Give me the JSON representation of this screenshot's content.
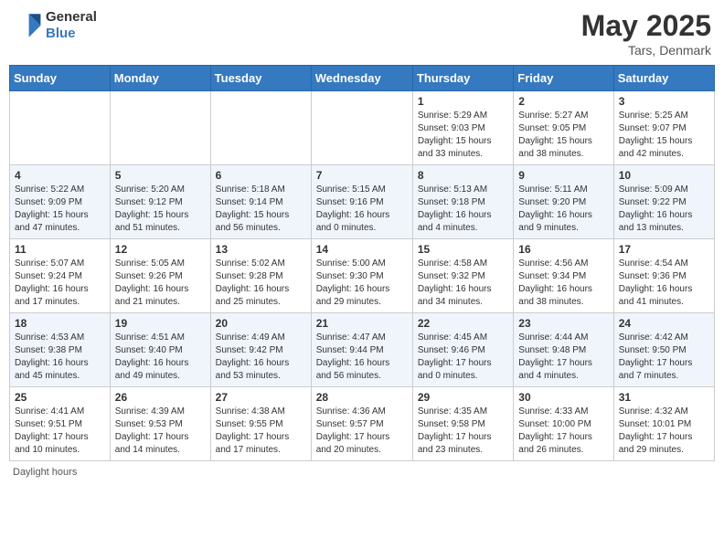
{
  "header": {
    "logo_line1": "General",
    "logo_line2": "Blue",
    "month_year": "May 2025",
    "location": "Tars, Denmark"
  },
  "days_of_week": [
    "Sunday",
    "Monday",
    "Tuesday",
    "Wednesday",
    "Thursday",
    "Friday",
    "Saturday"
  ],
  "weeks": [
    [
      {
        "day": "",
        "info": ""
      },
      {
        "day": "",
        "info": ""
      },
      {
        "day": "",
        "info": ""
      },
      {
        "day": "",
        "info": ""
      },
      {
        "day": "1",
        "info": "Sunrise: 5:29 AM\nSunset: 9:03 PM\nDaylight: 15 hours\nand 33 minutes."
      },
      {
        "day": "2",
        "info": "Sunrise: 5:27 AM\nSunset: 9:05 PM\nDaylight: 15 hours\nand 38 minutes."
      },
      {
        "day": "3",
        "info": "Sunrise: 5:25 AM\nSunset: 9:07 PM\nDaylight: 15 hours\nand 42 minutes."
      }
    ],
    [
      {
        "day": "4",
        "info": "Sunrise: 5:22 AM\nSunset: 9:09 PM\nDaylight: 15 hours\nand 47 minutes."
      },
      {
        "day": "5",
        "info": "Sunrise: 5:20 AM\nSunset: 9:12 PM\nDaylight: 15 hours\nand 51 minutes."
      },
      {
        "day": "6",
        "info": "Sunrise: 5:18 AM\nSunset: 9:14 PM\nDaylight: 15 hours\nand 56 minutes."
      },
      {
        "day": "7",
        "info": "Sunrise: 5:15 AM\nSunset: 9:16 PM\nDaylight: 16 hours\nand 0 minutes."
      },
      {
        "day": "8",
        "info": "Sunrise: 5:13 AM\nSunset: 9:18 PM\nDaylight: 16 hours\nand 4 minutes."
      },
      {
        "day": "9",
        "info": "Sunrise: 5:11 AM\nSunset: 9:20 PM\nDaylight: 16 hours\nand 9 minutes."
      },
      {
        "day": "10",
        "info": "Sunrise: 5:09 AM\nSunset: 9:22 PM\nDaylight: 16 hours\nand 13 minutes."
      }
    ],
    [
      {
        "day": "11",
        "info": "Sunrise: 5:07 AM\nSunset: 9:24 PM\nDaylight: 16 hours\nand 17 minutes."
      },
      {
        "day": "12",
        "info": "Sunrise: 5:05 AM\nSunset: 9:26 PM\nDaylight: 16 hours\nand 21 minutes."
      },
      {
        "day": "13",
        "info": "Sunrise: 5:02 AM\nSunset: 9:28 PM\nDaylight: 16 hours\nand 25 minutes."
      },
      {
        "day": "14",
        "info": "Sunrise: 5:00 AM\nSunset: 9:30 PM\nDaylight: 16 hours\nand 29 minutes."
      },
      {
        "day": "15",
        "info": "Sunrise: 4:58 AM\nSunset: 9:32 PM\nDaylight: 16 hours\nand 34 minutes."
      },
      {
        "day": "16",
        "info": "Sunrise: 4:56 AM\nSunset: 9:34 PM\nDaylight: 16 hours\nand 38 minutes."
      },
      {
        "day": "17",
        "info": "Sunrise: 4:54 AM\nSunset: 9:36 PM\nDaylight: 16 hours\nand 41 minutes."
      }
    ],
    [
      {
        "day": "18",
        "info": "Sunrise: 4:53 AM\nSunset: 9:38 PM\nDaylight: 16 hours\nand 45 minutes."
      },
      {
        "day": "19",
        "info": "Sunrise: 4:51 AM\nSunset: 9:40 PM\nDaylight: 16 hours\nand 49 minutes."
      },
      {
        "day": "20",
        "info": "Sunrise: 4:49 AM\nSunset: 9:42 PM\nDaylight: 16 hours\nand 53 minutes."
      },
      {
        "day": "21",
        "info": "Sunrise: 4:47 AM\nSunset: 9:44 PM\nDaylight: 16 hours\nand 56 minutes."
      },
      {
        "day": "22",
        "info": "Sunrise: 4:45 AM\nSunset: 9:46 PM\nDaylight: 17 hours\nand 0 minutes."
      },
      {
        "day": "23",
        "info": "Sunrise: 4:44 AM\nSunset: 9:48 PM\nDaylight: 17 hours\nand 4 minutes."
      },
      {
        "day": "24",
        "info": "Sunrise: 4:42 AM\nSunset: 9:50 PM\nDaylight: 17 hours\nand 7 minutes."
      }
    ],
    [
      {
        "day": "25",
        "info": "Sunrise: 4:41 AM\nSunset: 9:51 PM\nDaylight: 17 hours\nand 10 minutes."
      },
      {
        "day": "26",
        "info": "Sunrise: 4:39 AM\nSunset: 9:53 PM\nDaylight: 17 hours\nand 14 minutes."
      },
      {
        "day": "27",
        "info": "Sunrise: 4:38 AM\nSunset: 9:55 PM\nDaylight: 17 hours\nand 17 minutes."
      },
      {
        "day": "28",
        "info": "Sunrise: 4:36 AM\nSunset: 9:57 PM\nDaylight: 17 hours\nand 20 minutes."
      },
      {
        "day": "29",
        "info": "Sunrise: 4:35 AM\nSunset: 9:58 PM\nDaylight: 17 hours\nand 23 minutes."
      },
      {
        "day": "30",
        "info": "Sunrise: 4:33 AM\nSunset: 10:00 PM\nDaylight: 17 hours\nand 26 minutes."
      },
      {
        "day": "31",
        "info": "Sunrise: 4:32 AM\nSunset: 10:01 PM\nDaylight: 17 hours\nand 29 minutes."
      }
    ]
  ],
  "footer": {
    "daylight_hours_label": "Daylight hours"
  }
}
